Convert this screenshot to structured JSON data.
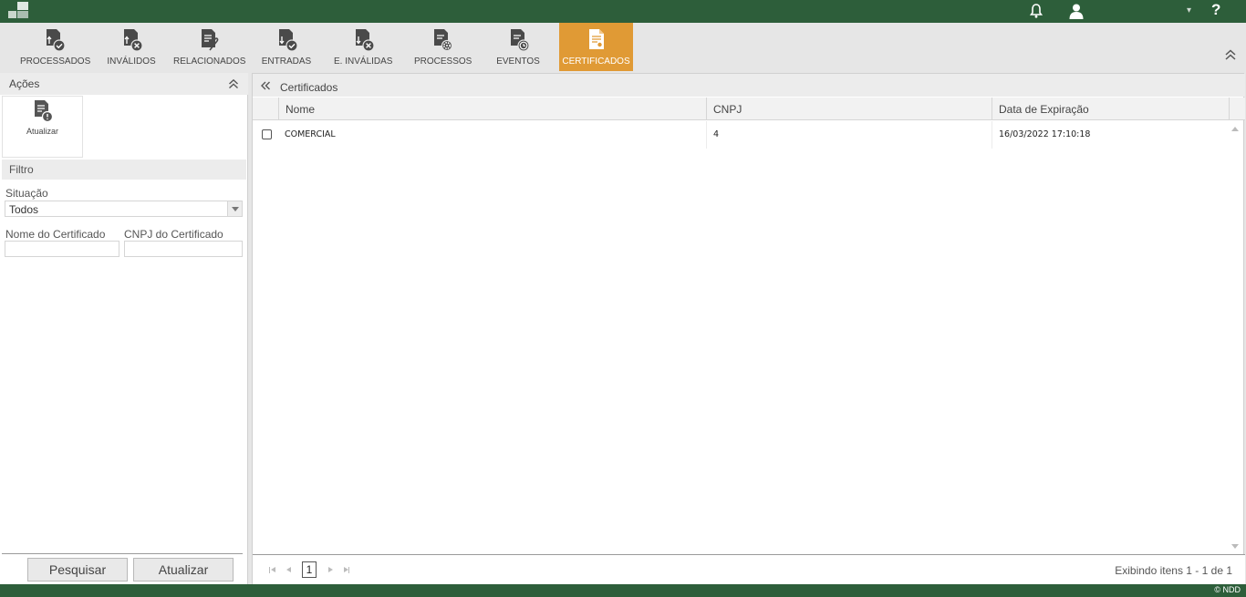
{
  "brand": {
    "primary": "#2d5e3a",
    "accent": "#e09a35"
  },
  "topbar": {
    "notifications_icon": "bell-icon",
    "user_icon": "user-icon",
    "dropdown_glyph": "▾",
    "help_glyph": "?"
  },
  "tabs": [
    {
      "label": "PROCESSADOS",
      "icon": "doc-check-icon"
    },
    {
      "label": "INVÁLIDOS",
      "icon": "doc-x-icon"
    },
    {
      "label": "RELACIONADOS",
      "icon": "doc-clip-icon"
    },
    {
      "label": "ENTRADAS",
      "icon": "doc-in-check-icon"
    },
    {
      "label": "E. INVÁLIDAS",
      "icon": "doc-in-x-icon"
    },
    {
      "label": "PROCESSOS",
      "icon": "doc-gear-icon"
    },
    {
      "label": "EVENTOS",
      "icon": "doc-clock-icon"
    },
    {
      "label": "CERTIFICADOS",
      "icon": "certificate-icon",
      "active": true
    }
  ],
  "left": {
    "acoes_title": "Ações",
    "action_atualizar": "Atualizar",
    "filtro_title": "Filtro",
    "situacao_label": "Situação",
    "situacao_value": "Todos",
    "nome_label": "Nome do Certificado",
    "nome_value": "",
    "cnpj_label": "CNPJ do Certificado",
    "cnpj_value": "",
    "btn_pesquisar": "Pesquisar",
    "btn_atualizar": "Atualizar"
  },
  "main": {
    "title": "Certificados",
    "columns": [
      "Nome",
      "CNPJ",
      "Data de Expiração"
    ],
    "rows": [
      {
        "nome": "COMERCIAL",
        "cnpj": "4",
        "data": "16/03/2022 17:10:18"
      }
    ],
    "page": "1",
    "pager_info": "Exibindo itens 1 - 1 de 1"
  },
  "footer": {
    "copyright": "© NDD"
  }
}
